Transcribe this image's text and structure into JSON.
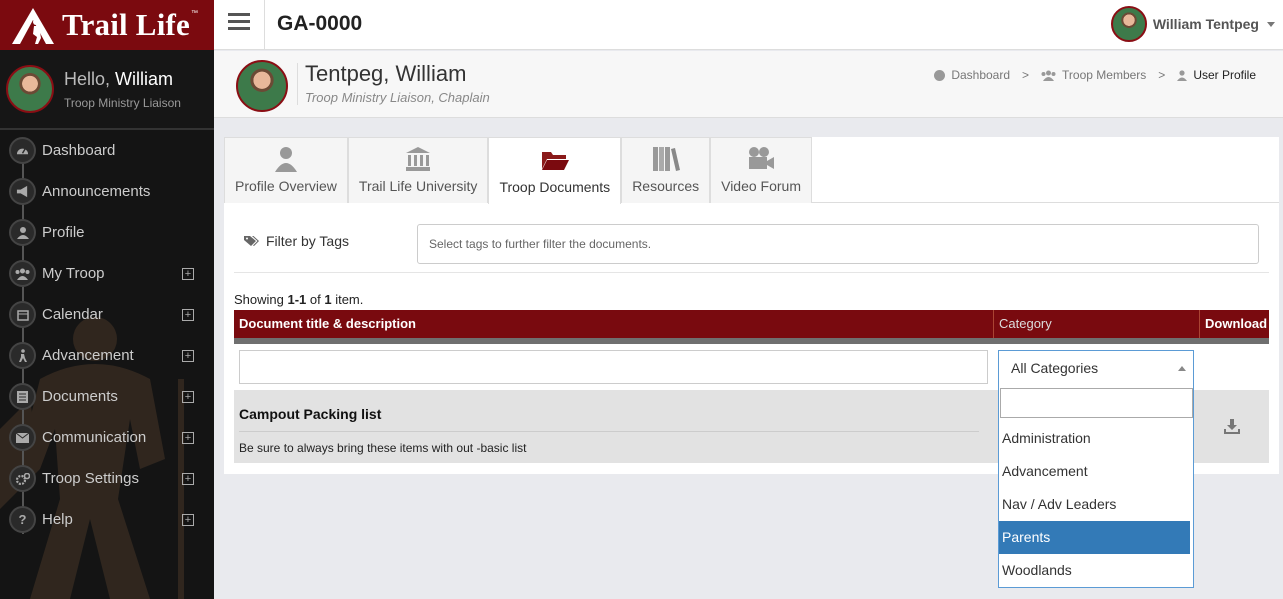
{
  "brand": {
    "logo_text": "Trail Life",
    "tm": "™"
  },
  "sidebar": {
    "greeting": "Hello,",
    "first_name": "William",
    "role": "Troop Ministry Liaison",
    "items": [
      {
        "label": "Dashboard",
        "icon": "dashboard-icon",
        "expandable": false
      },
      {
        "label": "Announcements",
        "icon": "megaphone-icon",
        "expandable": false
      },
      {
        "label": "Profile",
        "icon": "user-icon",
        "expandable": false
      },
      {
        "label": "My Troop",
        "icon": "users-icon",
        "expandable": true
      },
      {
        "label": "Calendar",
        "icon": "calendar-icon",
        "expandable": true
      },
      {
        "label": "Advancement",
        "icon": "hiker-icon",
        "expandable": true
      },
      {
        "label": "Documents",
        "icon": "document-icon",
        "expandable": true
      },
      {
        "label": "Communication",
        "icon": "envelope-icon",
        "expandable": true
      },
      {
        "label": "Troop Settings",
        "icon": "gears-icon",
        "expandable": true
      },
      {
        "label": "Help",
        "icon": "question-icon",
        "expandable": true
      }
    ],
    "plus_glyph": "+"
  },
  "topbar": {
    "troop_code": "GA-0000",
    "user_name": "William Tentpeg"
  },
  "profile": {
    "name": "Tentpeg, William",
    "roles": "Troop Ministry Liaison, Chaplain"
  },
  "breadcrumb": {
    "items": [
      "Dashboard",
      "Troop Members",
      "User Profile"
    ],
    "separator": ">"
  },
  "tabs": [
    {
      "label": "Profile Overview",
      "icon": "person-icon",
      "active": false
    },
    {
      "label": "Trail Life University",
      "icon": "university-icon",
      "active": false
    },
    {
      "label": "Troop Documents",
      "icon": "folder-open-icon",
      "active": true
    },
    {
      "label": "Resources",
      "icon": "books-icon",
      "active": false
    },
    {
      "label": "Video Forum",
      "icon": "video-camera-icon",
      "active": false
    }
  ],
  "filter": {
    "label": "Filter by Tags",
    "placeholder": "Select tags to further filter the documents."
  },
  "summary": {
    "prefix": "Showing ",
    "range": "1-1",
    "of": " of ",
    "total": "1",
    "suffix": " item."
  },
  "grid": {
    "columns": [
      "Document title & description",
      "Category",
      "Download"
    ],
    "rows": [
      {
        "title": "Campout Packing list",
        "description": "Be sure to always bring these items with out -basic list"
      }
    ]
  },
  "category_select": {
    "value": "All Categories",
    "options": [
      "Administration",
      "Advancement",
      "Nav / Adv Leaders",
      "Parents",
      "Woodlands"
    ],
    "highlighted": "Parents"
  },
  "colors": {
    "brand_red": "#7b0a0f",
    "highlight_blue": "#337ab7"
  }
}
